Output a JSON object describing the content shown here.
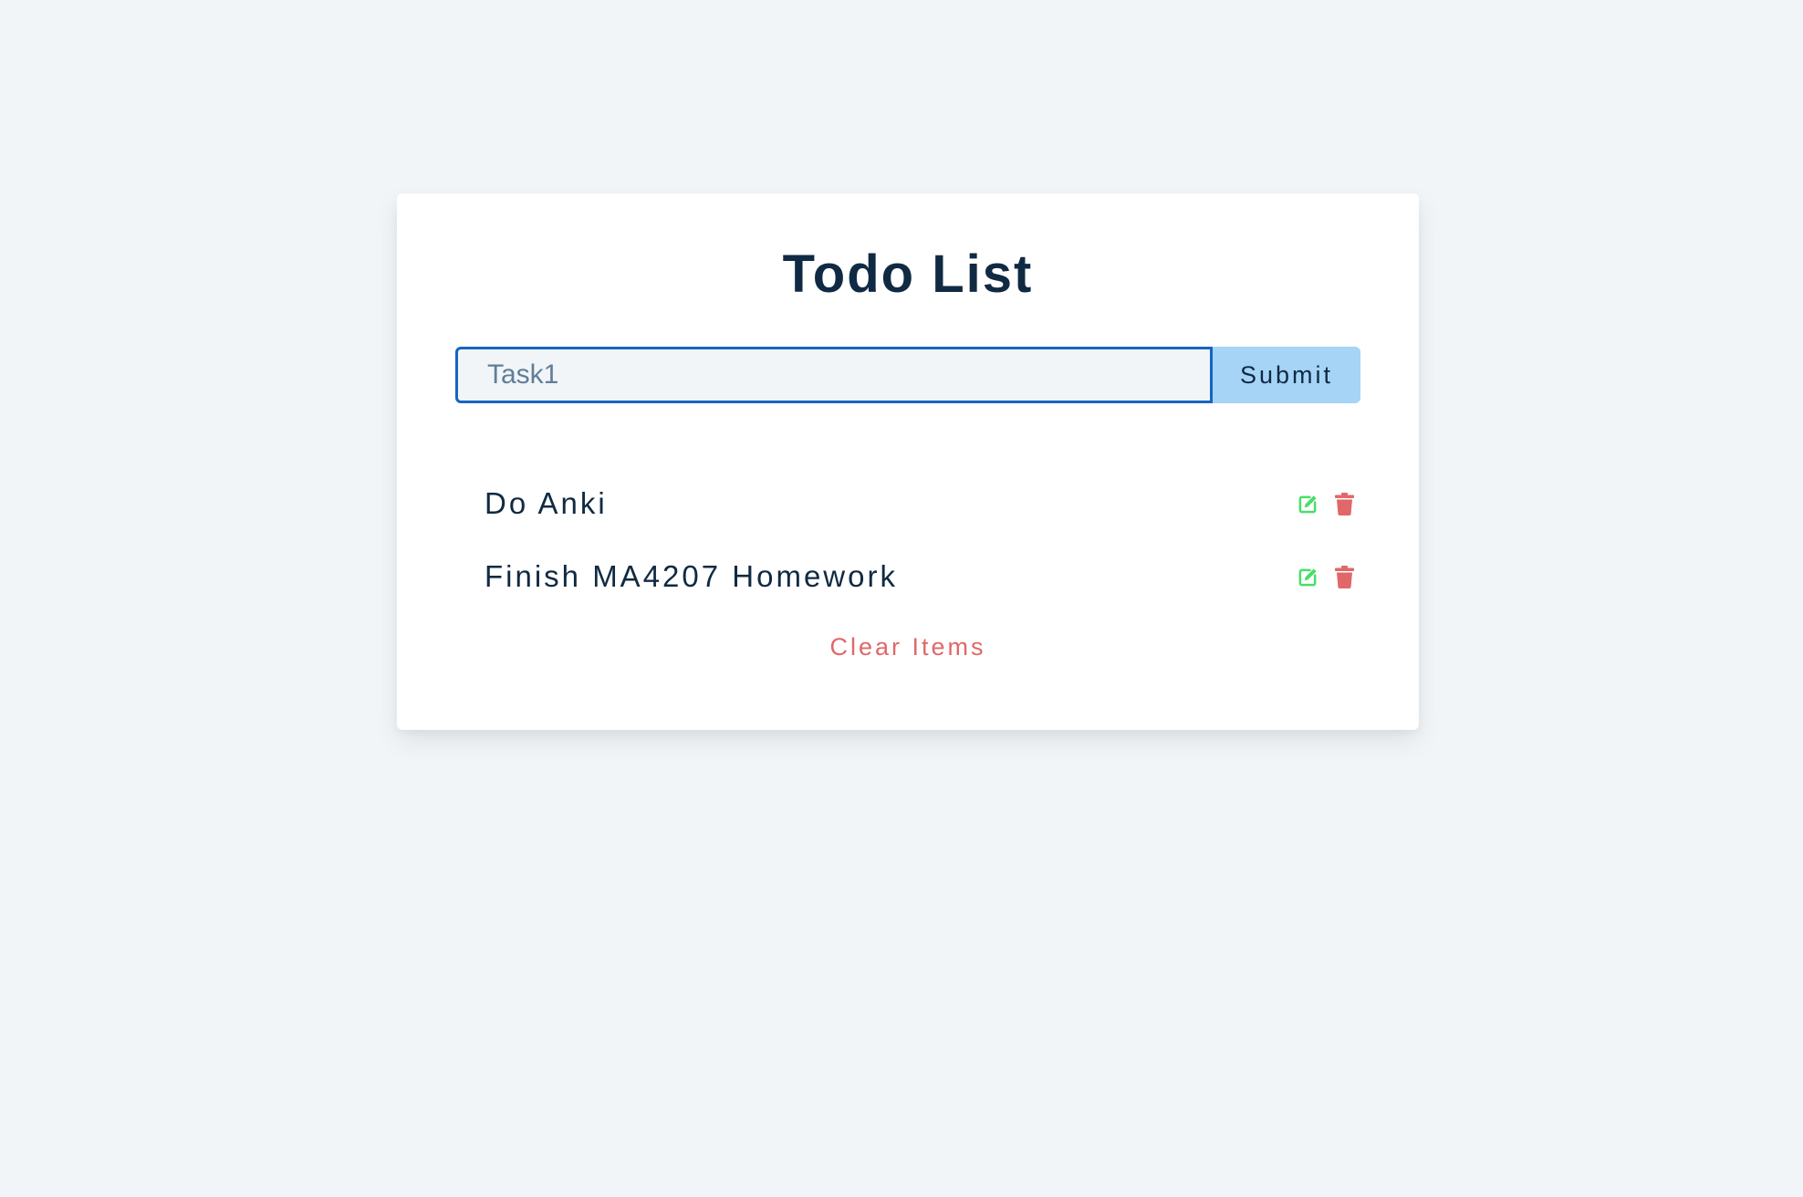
{
  "app": {
    "title": "Todo List"
  },
  "form": {
    "input_value": "",
    "input_placeholder": "Task1",
    "submit_label": "Submit"
  },
  "items": [
    {
      "label": "Do Anki"
    },
    {
      "label": "Finish MA4207 Homework"
    }
  ],
  "clear_label": "Clear Items",
  "icons": {
    "edit": "edit-icon",
    "delete": "trash-icon"
  },
  "colors": {
    "background": "#f1f5f8",
    "title": "#102a43",
    "input_border": "#1565c0",
    "submit_bg": "#a5d4f7",
    "edit_icon": "#4ade6a",
    "delete_icon": "#e06868",
    "clear_text": "#e06868"
  }
}
